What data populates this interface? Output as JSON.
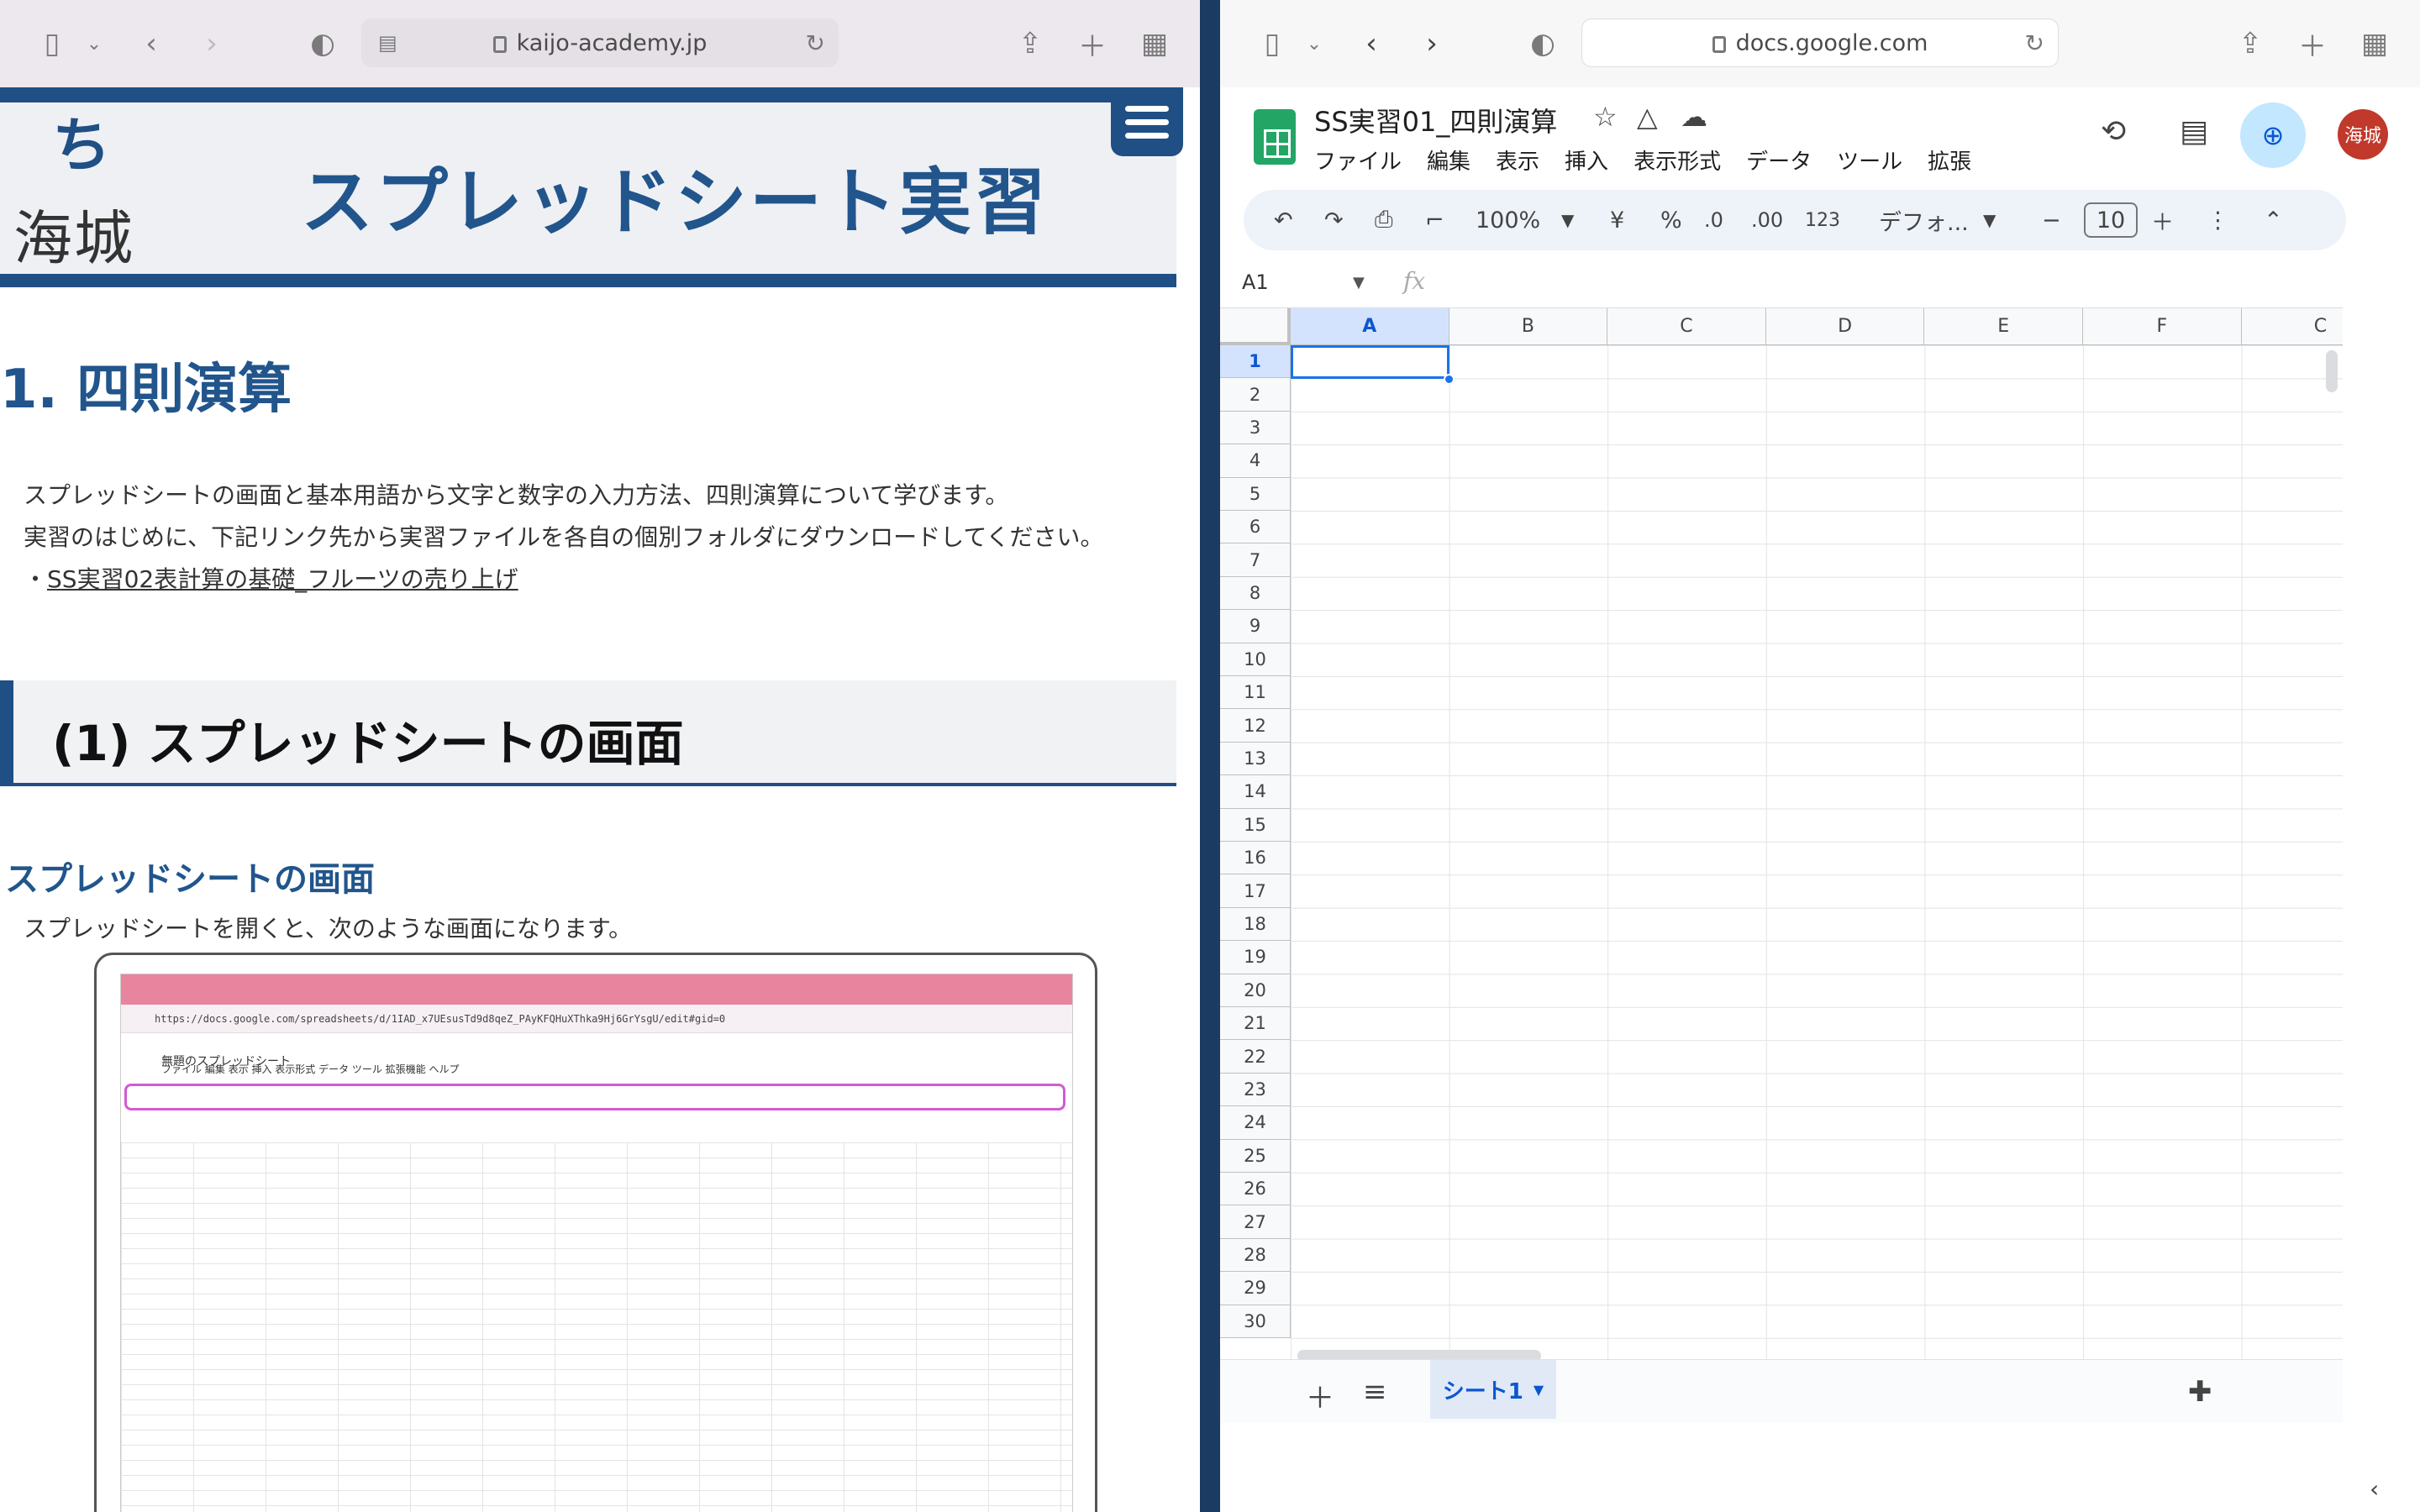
{
  "left": {
    "url": "kaijo-academy.jp",
    "logo_text": "海城",
    "site_title": "スプレッドシート実習",
    "h1": "1. 四則演算",
    "intro": [
      "スプレッドシートの画面と基本用語から文字と数字の入力方法、四則演算について学びます。",
      "実習のはじめに、下記リンク先から実習ファイルを各自の個別フォルダにダウンロードしてください。"
    ],
    "link_prefix": "・",
    "link": "SS実習02表計算の基礎_フルーツの売り上げ",
    "section_title": "(1) スプレッドシートの画面",
    "subsection": "スプレッドシートの画面",
    "subsection_text": "スプレッドシートを開くと、次のような画面になります。",
    "shot": {
      "url": "https://docs.google.com/spreadsheets/d/1IAD_x7UEsusTd9d8qeZ_PAyKFQHuXThka9Hj6GrYsgU/edit#gid=0",
      "title": "無題のスプレッドシート",
      "menu": "ファイル 編集 表示 挿入 表示形式 データ ツール 拡張機能 ヘルプ"
    }
  },
  "right": {
    "url": "docs.google.com",
    "doc_title": "SS実習01_四則演算",
    "menus": [
      "ファイル",
      "編集",
      "表示",
      "挿入",
      "表示形式",
      "データ",
      "ツール",
      "拡張"
    ],
    "avatar": "海城",
    "toolbar": {
      "zoom": "100%",
      "yen": "¥",
      "pct": "%",
      "dec_minus": ".0",
      "dec_plus": ".00",
      "num": "123",
      "font": "デフォ...",
      "size": "10"
    },
    "namebox": "A1",
    "fx": "fx",
    "columns": [
      "A",
      "B",
      "C",
      "D",
      "E",
      "F",
      "C"
    ],
    "rows": [
      "1",
      "2",
      "3",
      "4",
      "5",
      "6",
      "7",
      "8",
      "9",
      "10",
      "11",
      "12",
      "13",
      "14",
      "15",
      "16",
      "17",
      "18",
      "19",
      "20",
      "21",
      "22",
      "23",
      "24",
      "25",
      "26",
      "27",
      "28",
      "29",
      "30"
    ],
    "sheet_tab": "シート1"
  }
}
